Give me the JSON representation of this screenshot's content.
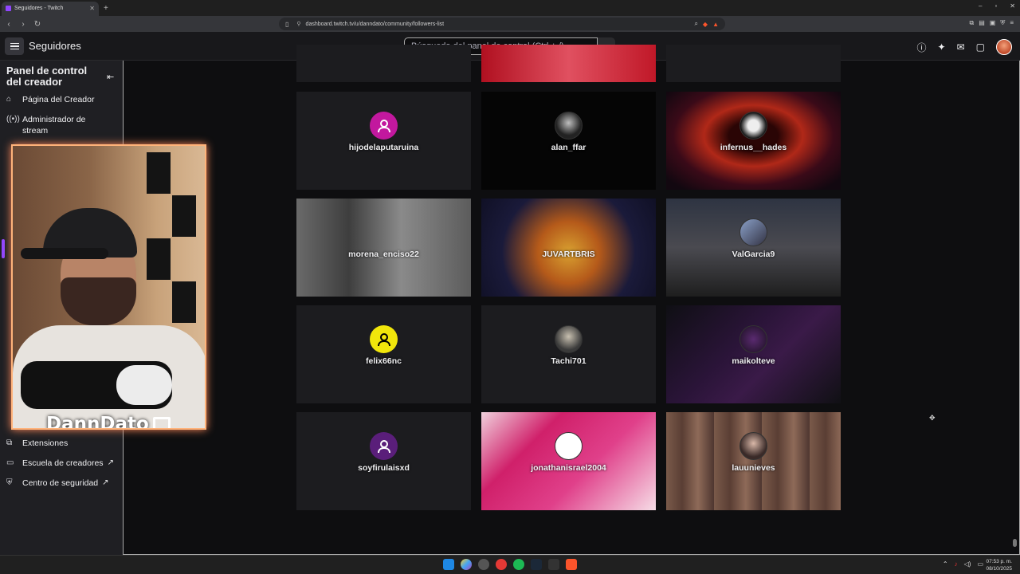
{
  "browser": {
    "tab_title": "Seguidores - Twitch",
    "url": "dashboard.twitch.tv/u/danndato/community/followers-list"
  },
  "topbar": {
    "page_title": "Seguidores",
    "search_placeholder": "Búsqueda del panel de control (Ctrl + /)"
  },
  "sidebar": {
    "heading": "Panel de control del creador",
    "items": [
      {
        "label": "Página del Creador",
        "icon": "home-icon"
      },
      {
        "label": "Administrador de stream",
        "icon": "broadcast-icon"
      },
      {
        "label": "Extensiones",
        "icon": "extensions-icon"
      },
      {
        "label": "Escuela de creadores",
        "icon": "book-icon",
        "external": true
      },
      {
        "label": "Centro de seguridad",
        "icon": "shield-icon",
        "external": true
      }
    ]
  },
  "webcam": {
    "overlay_name": "DannDato"
  },
  "followers": [
    {
      "name": "hijodelaputaruina",
      "avatar": "default",
      "color": "#c2189e"
    },
    {
      "name": "alan_ffar",
      "avatar": "photo",
      "color": "#2b2b2b"
    },
    {
      "name": "infernus__hades",
      "avatar": "skull",
      "color": "#5a1010"
    },
    {
      "name": "morena_enciso22",
      "avatar": "none",
      "color": "#777"
    },
    {
      "name": "JUVARTBRIS",
      "avatar": "none",
      "color": "#b33"
    },
    {
      "name": "ValGarcia9",
      "avatar": "photo",
      "color": "#6a7c9a"
    },
    {
      "name": "felix66nc",
      "avatar": "default",
      "color": "#f1e60b"
    },
    {
      "name": "Tachi701",
      "avatar": "photo",
      "color": "#556"
    },
    {
      "name": "maikolteve",
      "avatar": "logo",
      "color": "#7b2d8c"
    },
    {
      "name": "soyfirulaisxd",
      "avatar": "default",
      "color": "#5a1e7a"
    },
    {
      "name": "jonathanisrael2004",
      "avatar": "photo",
      "color": "#ffffff"
    },
    {
      "name": "lauunieves",
      "avatar": "photo",
      "color": "#6b4e46"
    }
  ],
  "taskbar": {
    "time": "07:53 p. m.",
    "date": "08/10/2025"
  }
}
